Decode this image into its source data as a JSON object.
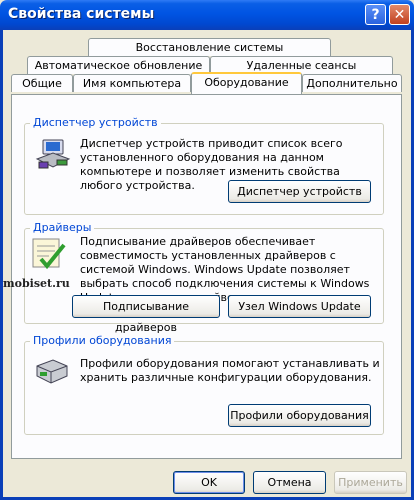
{
  "window": {
    "title": "Свойства системы",
    "help_label": "?",
    "close_label": "✕"
  },
  "tabs": {
    "row1": [
      "Восстановление системы"
    ],
    "row2": [
      "Автоматическое обновление",
      "Удаленные сеансы"
    ],
    "row3": [
      "Общие",
      "Имя компьютера",
      "Оборудование",
      "Дополнительно"
    ],
    "active": "Оборудование"
  },
  "device_manager": {
    "title": "Диспетчер устройств",
    "text": "Диспетчер устройств приводит список всего установленного оборудования на данном компьютере и позволяет изменить свойства любого устройства.",
    "button": "Диспетчер устройств",
    "icon": "device-manager-icon"
  },
  "drivers": {
    "title": "Драйверы",
    "text": "Подписывание драйверов обеспечивает совместимость установленных драйверов с системой Windows. Windows Update позволяет выбрать способ подключения системы к Windows Update для поиска драйверов.",
    "sign_button": "Подписывание драйверов",
    "update_button": "Узел Windows Update",
    "icon": "driver-signing-icon"
  },
  "profiles": {
    "title": "Профили оборудования",
    "text": "Профили оборудования помогают устанавливать и хранить различные конфигурации оборудования.",
    "button": "Профили оборудования",
    "icon": "hardware-profile-icon"
  },
  "watermark": "mobiset.ru",
  "footer": {
    "ok": "OK",
    "cancel": "Отмена",
    "apply": "Применить"
  }
}
